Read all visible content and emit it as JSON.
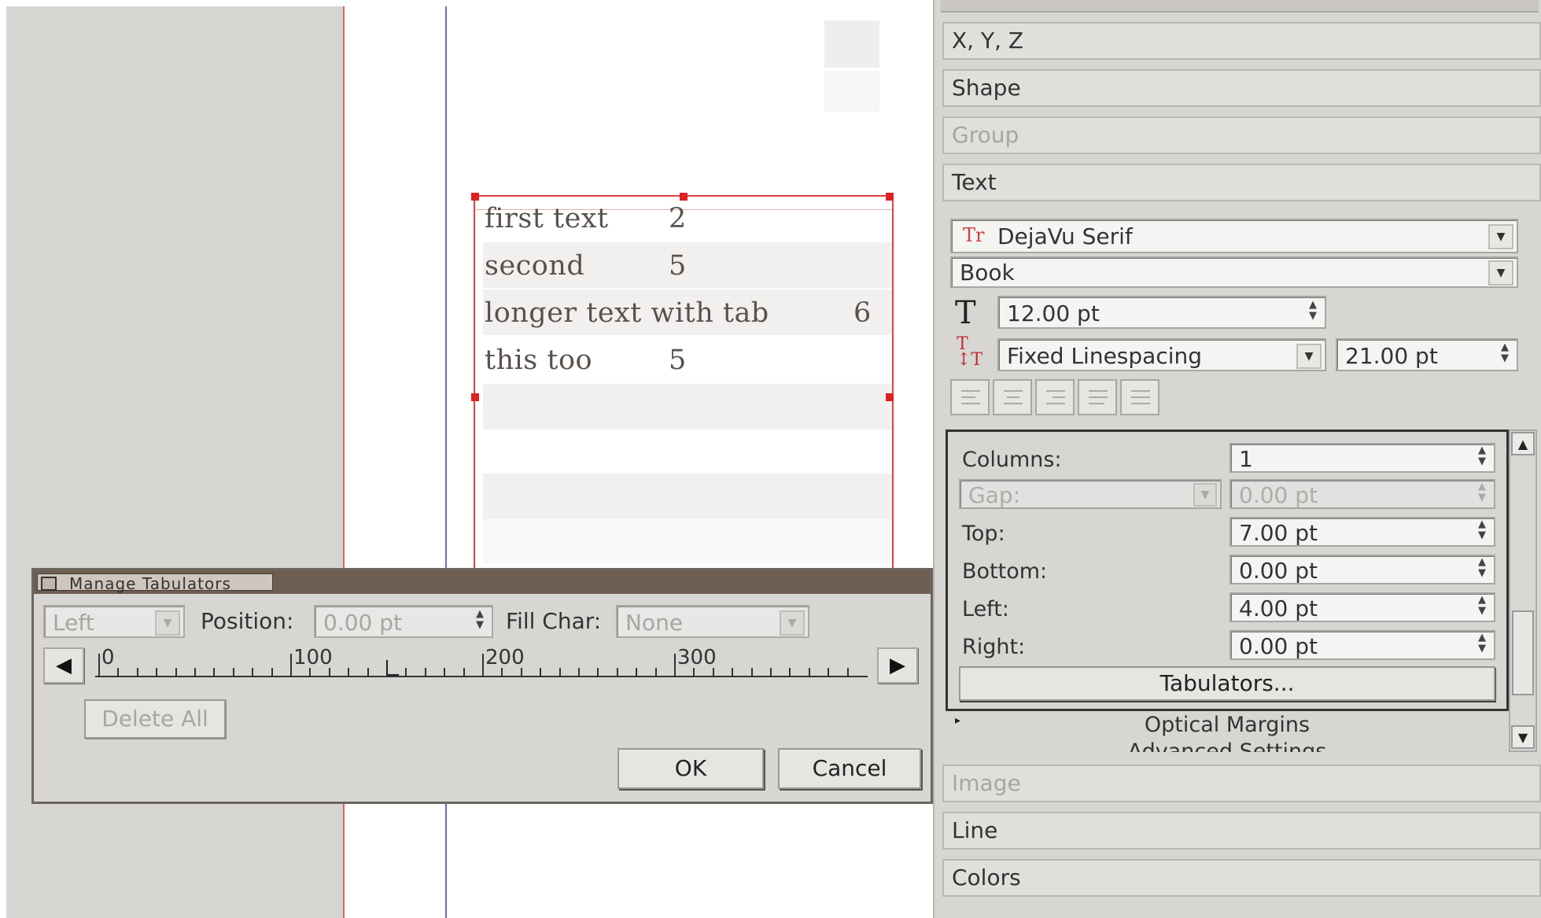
{
  "document": {
    "frame_lines": [
      {
        "label": "first text",
        "value": "2"
      },
      {
        "label": "second",
        "value": "5"
      },
      {
        "label": "longer text with tab",
        "value": "6"
      },
      {
        "label": "this too",
        "value": "5"
      }
    ]
  },
  "dialog": {
    "title": "Manage Tabulators",
    "alignment_value": "Left",
    "position_label": "Position:",
    "position_value": "0.00 pt",
    "fill_char_label": "Fill Char:",
    "fill_char_value": "None",
    "ruler_labels": [
      "0",
      "100",
      "200",
      "300"
    ],
    "delete_all_label": "Delete All",
    "ok_label": "OK",
    "cancel_label": "Cancel",
    "title_bar_color": "#6e5e52"
  },
  "properties": {
    "sections": {
      "xyz": "X, Y, Z",
      "shape": "Shape",
      "group": "Group",
      "text": "Text",
      "image": "Image",
      "line": "Line",
      "colors": "Colors"
    },
    "font_family": "DejaVu Serif",
    "font_style": "Book",
    "font_size": "12.00 pt",
    "linespacing_mode": "Fixed Linespacing",
    "linespacing_value": "21.00 pt",
    "columns_label": "Columns:",
    "columns_value": "1",
    "gap_label": "Gap:",
    "gap_value": "0.00 pt",
    "top_label": "Top:",
    "top_value": "7.00 pt",
    "bottom_label": "Bottom:",
    "bottom_value": "0.00 pt",
    "left_label": "Left:",
    "left_value": "4.00 pt",
    "right_label": "Right:",
    "right_value": "0.00 pt",
    "tabulators_label": "Tabulators...",
    "optical_margins_label": "Optical Margins",
    "advanced_settings_label": "Advanced Settings"
  },
  "icons": [
    "font-type-icon",
    "font-size-icon",
    "linespacing-icon",
    "align-left-icon",
    "align-center-icon",
    "align-right-icon",
    "align-block-icon",
    "align-forced-icon",
    "scroll-left-icon",
    "scroll-right-icon",
    "expand-arrow-icon"
  ],
  "colors": {
    "frame_border": "#e04040",
    "margin_guide": "#6b6bd8",
    "panel_bg": "#d8d6d3"
  }
}
